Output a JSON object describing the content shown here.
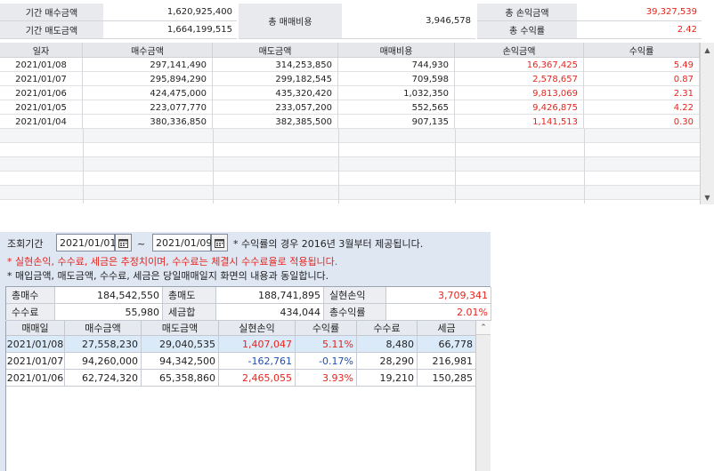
{
  "summary": {
    "buy_label": "기간 매수금액",
    "buy_value": "1,620,925,400",
    "sell_label": "기간 매도금액",
    "sell_value": "1,664,199,515",
    "fee_label": "총 매매비용",
    "fee_value": "3,946,578",
    "pnl_label": "총 손익금액",
    "pnl_value": "39,327,539",
    "rate_label": "총 수익률",
    "rate_value": "2.42"
  },
  "top_table": {
    "headers": [
      "일자",
      "매수금액",
      "매도금액",
      "매매비용",
      "손익금액",
      "수익률"
    ],
    "rows": [
      [
        "2021/01/08",
        "297,141,490",
        "314,253,850",
        "744,930",
        "16,367,425",
        "5.49"
      ],
      [
        "2021/01/07",
        "295,894,290",
        "299,182,545",
        "709,598",
        "2,578,657",
        "0.87"
      ],
      [
        "2021/01/06",
        "424,475,000",
        "435,320,420",
        "1,032,350",
        "9,813,069",
        "2.31"
      ],
      [
        "2021/01/05",
        "223,077,770",
        "233,057,200",
        "552,565",
        "9,426,875",
        "4.22"
      ],
      [
        "2021/01/04",
        "380,336,850",
        "382,385,500",
        "907,135",
        "1,141,513",
        "0.30"
      ]
    ]
  },
  "query": {
    "label": "조회기간",
    "start_date": "2021/01/01",
    "tilde": "~",
    "end_date": "2021/01/09",
    "note1": "* 수익률의 경우 2016년 3월부터 제공됩니다.",
    "note2": "* 실현손익, 수수료, 세금은 추정치이며, 수수료는 체결시 수수료율로 적용됩니다.",
    "note3": "* 매입금액, 매도금액, 수수료, 세금은 당일매매일지 화면의 내용과 동일합니다."
  },
  "bottom_summary": {
    "total_buy_label": "총매수",
    "total_buy": "184,542,550",
    "total_sell_label": "총매도",
    "total_sell": "188,741,895",
    "realized_label": "실현손익",
    "realized": "3,709,341",
    "fee_label": "수수료",
    "fee": "55,980",
    "tax_label": "세금합",
    "tax": "434,044",
    "rate_label": "총수익률",
    "rate": "2.01%"
  },
  "bottom_table": {
    "headers": [
      "매매일",
      "매수금액",
      "매도금액",
      "실현손익",
      "수익률",
      "수수료",
      "세금"
    ],
    "rows": [
      [
        "2021/01/08",
        "27,558,230",
        "29,040,535",
        "1,407,047",
        "5.11%",
        "8,480",
        "66,778"
      ],
      [
        "2021/01/07",
        "94,260,000",
        "94,342,500",
        "-162,761",
        "-0.17%",
        "28,290",
        "216,981"
      ],
      [
        "2021/01/06",
        "62,724,320",
        "65,358,860",
        "2,465,055",
        "3.93%",
        "19,210",
        "150,285"
      ]
    ]
  },
  "colors": {
    "profit": "#e8241c",
    "loss": "#1f4fb5",
    "panel_bg": "#dfe7f3",
    "selected_row": "#dbeaf9"
  }
}
